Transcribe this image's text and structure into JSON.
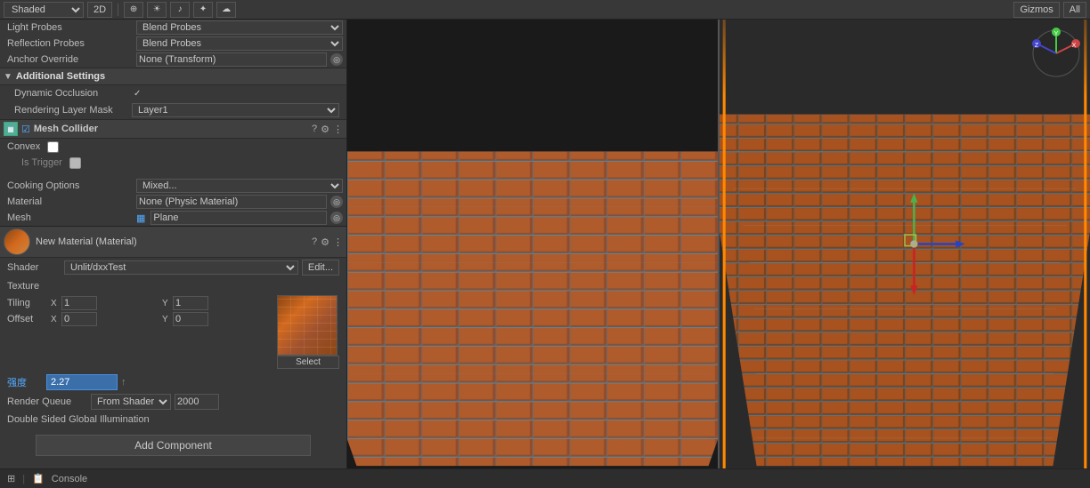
{
  "topbar": {
    "shading_mode": "Shaded",
    "view_2d": "2D",
    "gizmos_label": "Gizmos",
    "all_label": "All"
  },
  "inspector": {
    "light_probes_label": "Light Probes",
    "light_probes_value": "Blend Probes",
    "reflection_probes_label": "Reflection Probes",
    "reflection_probes_value": "Blend Probes",
    "anchor_override_label": "Anchor Override",
    "anchor_override_value": "None (Transform)",
    "additional_settings_title": "Additional Settings",
    "dynamic_occlusion_label": "Dynamic Occlusion",
    "rendering_layer_label": "Rendering Layer Mask",
    "rendering_layer_value": "Layer1",
    "mesh_collider_title": "Mesh Collider",
    "convex_label": "Convex",
    "is_trigger_label": "Is Trigger",
    "cooking_options_label": "Cooking Options",
    "cooking_options_value": "Mixed...",
    "material_label": "Material",
    "material_value": "None (Physic Material)",
    "mesh_label": "Mesh",
    "mesh_value": "Plane",
    "new_material_title": "New Material (Material)",
    "shader_label": "Shader",
    "shader_value": "Unlit/dxxTest",
    "edit_label": "Edit...",
    "texture_label": "Texture",
    "tiling_label": "Tiling",
    "tiling_x": "1",
    "tiling_y": "1",
    "offset_label": "Offset",
    "offset_x": "0",
    "offset_y": "0",
    "select_label": "Select",
    "strength_label": "强度",
    "strength_value": "2.27",
    "render_queue_label": "Render Queue",
    "render_queue_mode": "From Shader",
    "render_queue_value": "2000",
    "double_sided_label": "Double Sided Global Illumination",
    "add_component_label": "Add Component"
  },
  "bottombar": {
    "icon1": "⊞",
    "console_label": "Console"
  }
}
